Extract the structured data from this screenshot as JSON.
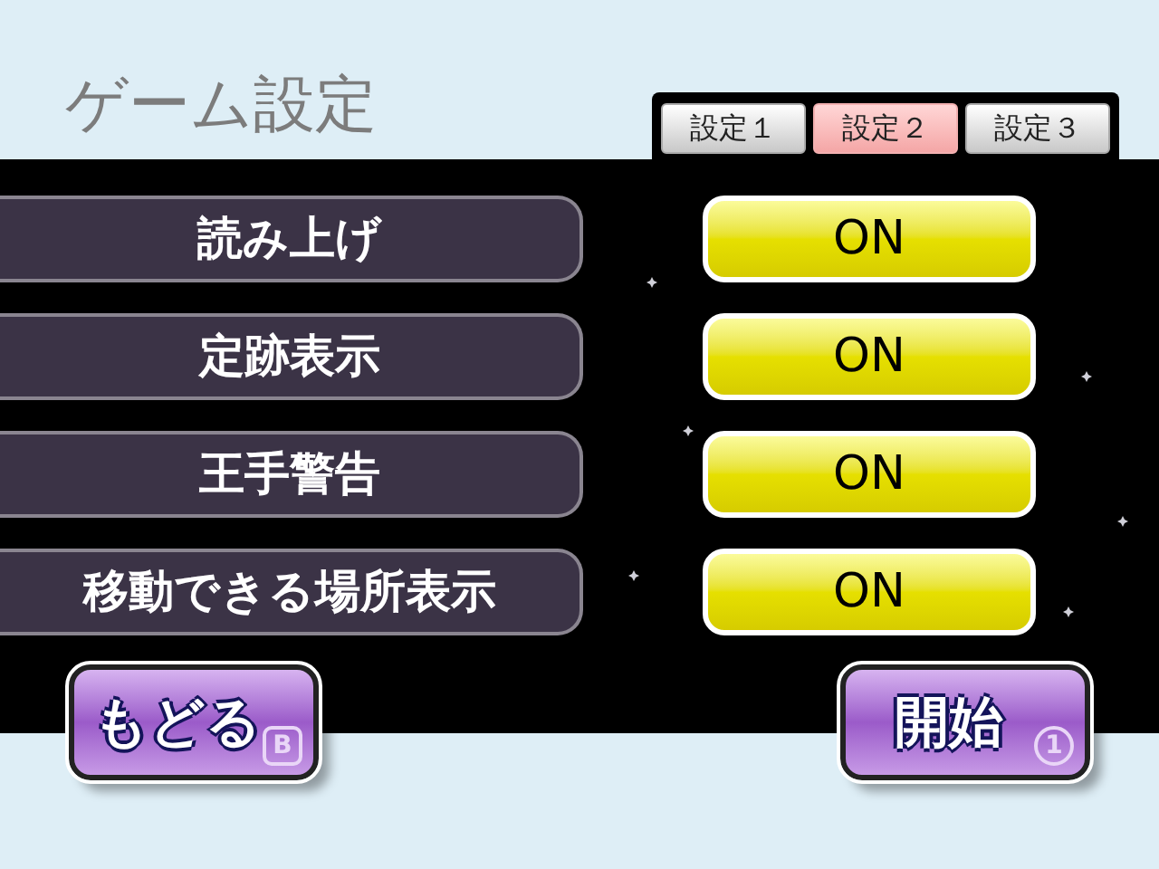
{
  "title": "ゲーム設定",
  "tabs": [
    {
      "label": "設定１",
      "selected": false
    },
    {
      "label": "設定２",
      "selected": true
    },
    {
      "label": "設定３",
      "selected": false
    }
  ],
  "settings": [
    {
      "label": "読み上げ",
      "value": "ON",
      "on": true
    },
    {
      "label": "定跡表示",
      "value": "ON",
      "on": true
    },
    {
      "label": "王手警告",
      "value": "ON",
      "on": true
    },
    {
      "label": "移動できる場所表示",
      "value": "ON",
      "on": true
    }
  ],
  "buttons": [
    {
      "label": "もどる",
      "key": "B",
      "kind": "square"
    },
    {
      "label": "開始",
      "key": "1",
      "kind": "circle"
    }
  ]
}
